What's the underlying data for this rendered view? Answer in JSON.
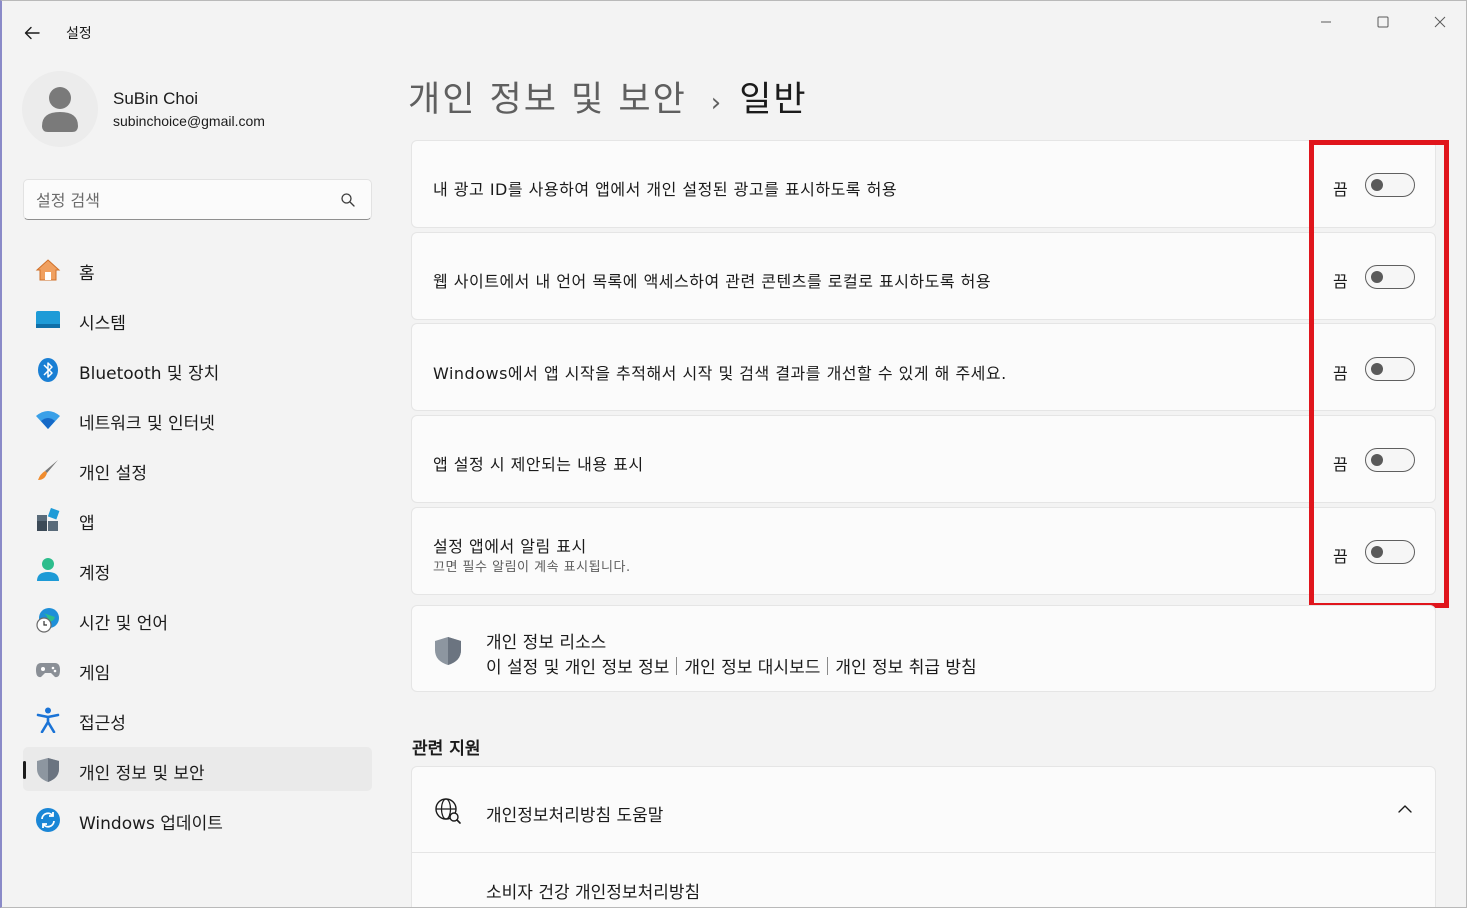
{
  "window": {
    "title": "설정"
  },
  "profile": {
    "name": "SuBin Choi",
    "email": "subinchoice@gmail.com"
  },
  "search": {
    "placeholder": "설정 검색"
  },
  "sidebar": {
    "items": [
      {
        "label": "홈",
        "icon": "home-icon"
      },
      {
        "label": "시스템",
        "icon": "system-icon"
      },
      {
        "label": "Bluetooth 및 장치",
        "icon": "bluetooth-icon"
      },
      {
        "label": "네트워크 및 인터넷",
        "icon": "wifi-icon"
      },
      {
        "label": "개인 설정",
        "icon": "brush-icon"
      },
      {
        "label": "앱",
        "icon": "apps-icon"
      },
      {
        "label": "계정",
        "icon": "account-icon"
      },
      {
        "label": "시간 및 언어",
        "icon": "globe-clock-icon"
      },
      {
        "label": "게임",
        "icon": "gamepad-icon"
      },
      {
        "label": "접근성",
        "icon": "accessibility-icon"
      },
      {
        "label": "개인 정보 및 보안",
        "icon": "shield-icon",
        "active": true
      },
      {
        "label": "Windows 업데이트",
        "icon": "update-icon"
      }
    ]
  },
  "breadcrumb": {
    "parent": "개인 정보 및 보안",
    "separator": "›",
    "current": "일반"
  },
  "settings": [
    {
      "label": "내 광고 ID를 사용하여 앱에서 개인 설정된 광고를 표시하도록 허용",
      "state": "끔",
      "on": false
    },
    {
      "label": "웹 사이트에서 내 언어 목록에 액세스하여 관련 콘텐츠를 로컬로 표시하도록 허용",
      "state": "끔",
      "on": false
    },
    {
      "label": "Windows에서 앱 시작을 추적해서 시작 및 검색 결과를 개선할 수 있게 해 주세요.",
      "state": "끔",
      "on": false
    },
    {
      "label": "앱 설정 시 제안되는 내용 표시",
      "state": "끔",
      "on": false
    },
    {
      "label": "설정 앱에서 알림 표시",
      "sublabel": "끄면 필수 알림이 계속 표시됩니다.",
      "state": "끔",
      "on": false
    }
  ],
  "resources": {
    "title": "개인 정보 리소스",
    "links": [
      "이 설정 및 개인 정보 정보",
      "개인 정보 대시보드",
      "개인 정보 취급 방침"
    ]
  },
  "related": {
    "heading": "관련 지원",
    "help_title": "개인정보처리방침 도움말",
    "help_link": "소비자 건강 개인정보처리방침"
  },
  "colors": {
    "accent": "#0067c0",
    "highlight": "#e0151c",
    "background": "#f3f3f3",
    "card": "#fbfbfb"
  }
}
